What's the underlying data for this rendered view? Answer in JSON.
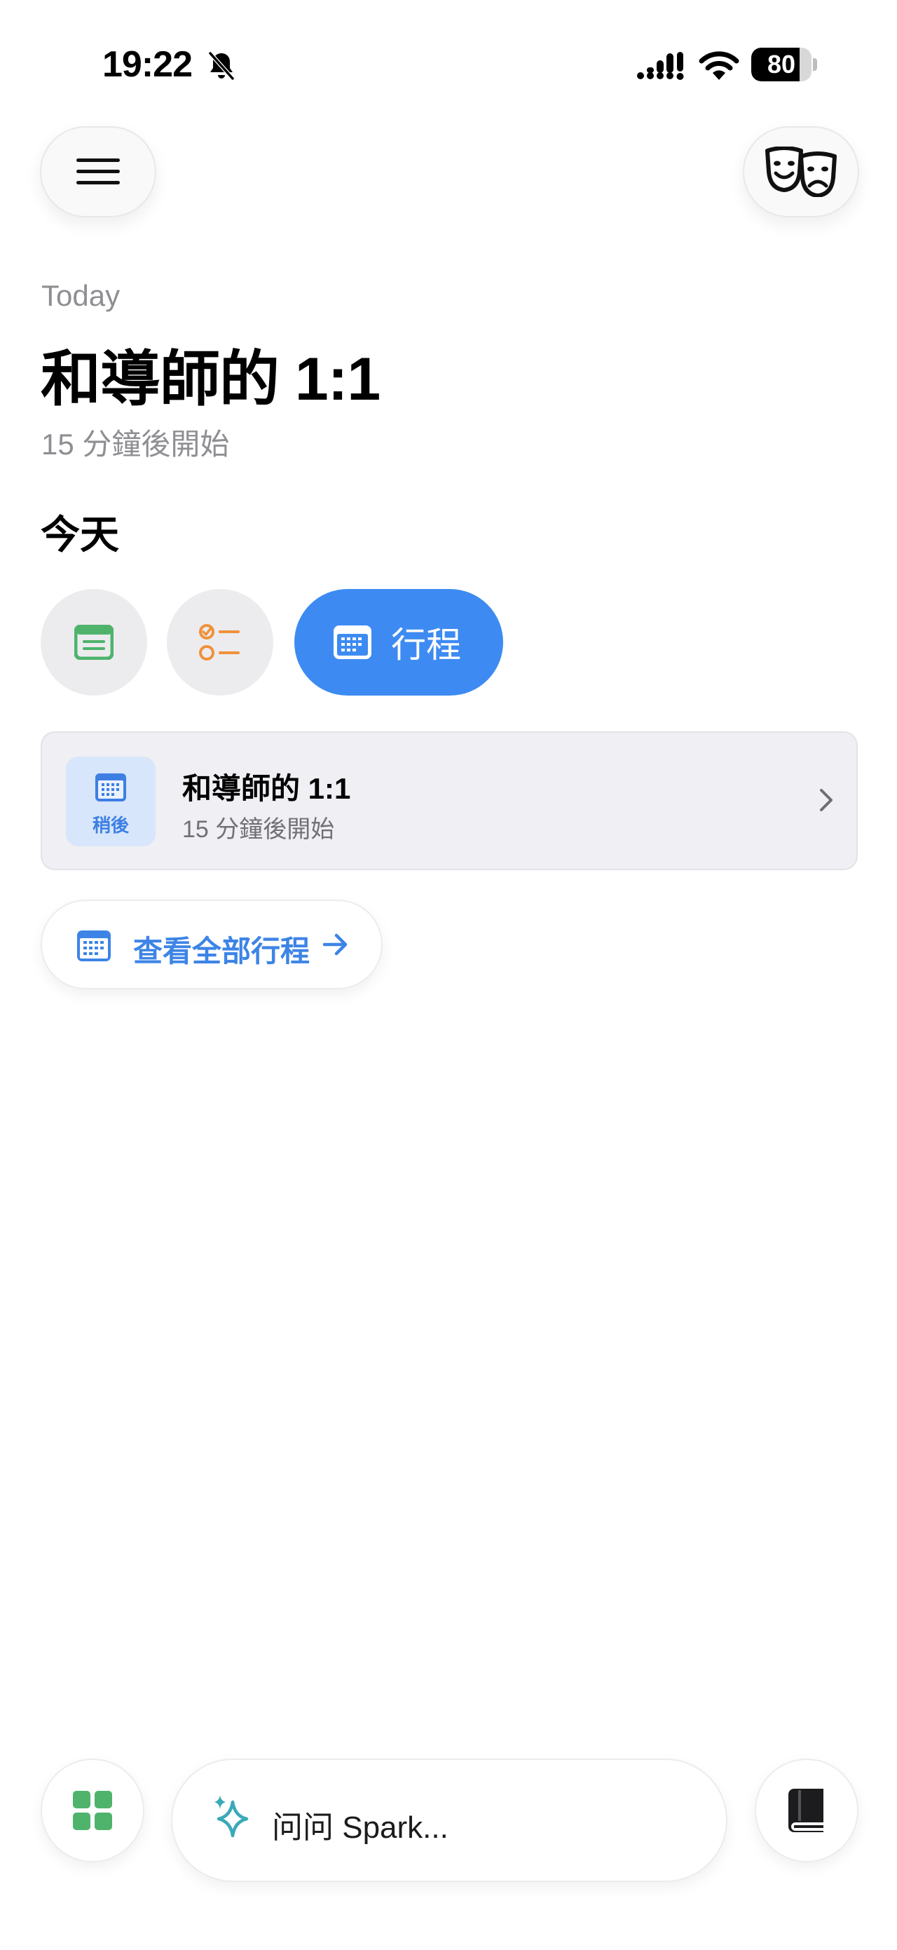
{
  "status_bar": {
    "time": "19:22",
    "battery": "80",
    "battery_level": 0.8
  },
  "header": {
    "today_label": "Today",
    "title": "和導師的 1:1",
    "subtitle": "15 分鐘後開始"
  },
  "section": {
    "title": "今天"
  },
  "filters": [
    {
      "icon": "notes-icon",
      "color": "#4fb36c"
    },
    {
      "icon": "tasks-icon",
      "color": "#f0913a"
    },
    {
      "icon": "calendar-icon",
      "label": "行程",
      "active": true,
      "color": "#3d8bf2"
    }
  ],
  "event_card": {
    "badge": "稍後",
    "title": "和導師的 1:1",
    "subtitle": "15 分鐘後開始"
  },
  "view_all": {
    "label": "查看全部行程"
  },
  "bottom_bar": {
    "ask_placeholder": "问问 Spark..."
  },
  "colors": {
    "accent": "#3d8bf2",
    "green": "#4fb36c",
    "orange": "#f0913a",
    "teal": "#3aa9b8"
  }
}
